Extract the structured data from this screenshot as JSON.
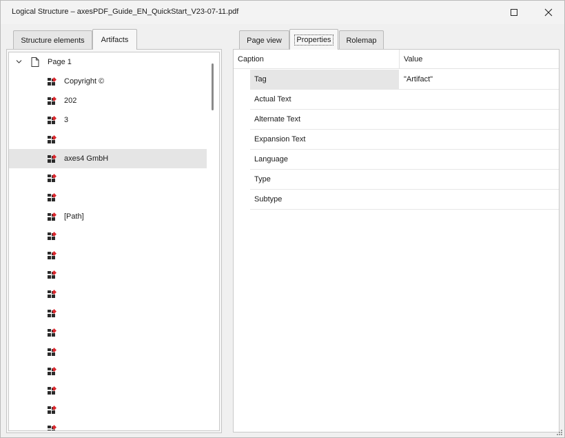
{
  "window": {
    "title": "Logical Structure – axesPDF_Guide_EN_QuickStart_V23-07-11.pdf"
  },
  "left_tabs": [
    {
      "label": "Structure elements",
      "active": false
    },
    {
      "label": "Artifacts",
      "active": true
    }
  ],
  "right_tabs": [
    {
      "label": "Page view",
      "active": false
    },
    {
      "label": "Properties",
      "active": true
    },
    {
      "label": "Rolemap",
      "active": false
    }
  ],
  "tree": {
    "root": {
      "label": "Page 1",
      "icon": "page-icon",
      "expanded": true
    },
    "items": [
      {
        "label": "Copyright ©"
      },
      {
        "label": "202"
      },
      {
        "label": "3"
      },
      {
        "label": ""
      },
      {
        "label": "axes4 GmbH",
        "selected": true
      },
      {
        "label": ""
      },
      {
        "label": ""
      },
      {
        "label": "[Path]"
      },
      {
        "label": ""
      },
      {
        "label": ""
      },
      {
        "label": ""
      },
      {
        "label": ""
      },
      {
        "label": ""
      },
      {
        "label": ""
      },
      {
        "label": ""
      },
      {
        "label": ""
      },
      {
        "label": ""
      },
      {
        "label": ""
      },
      {
        "label": ""
      }
    ],
    "item_icon": "artifact-icon"
  },
  "properties": {
    "columns": {
      "caption": "Caption",
      "value": "Value"
    },
    "rows": [
      {
        "caption": "Tag",
        "value": "\"Artifact\"",
        "highlighted": true
      },
      {
        "caption": "Actual Text",
        "value": ""
      },
      {
        "caption": "Alternate Text",
        "value": ""
      },
      {
        "caption": "Expansion Text",
        "value": ""
      },
      {
        "caption": "Language",
        "value": ""
      },
      {
        "caption": "Type",
        "value": ""
      },
      {
        "caption": "Subtype",
        "value": ""
      }
    ]
  },
  "colors": {
    "artifact_dark": "#2b2b2b",
    "artifact_accent": "#d9262c",
    "selection": "#e5e5e5"
  }
}
